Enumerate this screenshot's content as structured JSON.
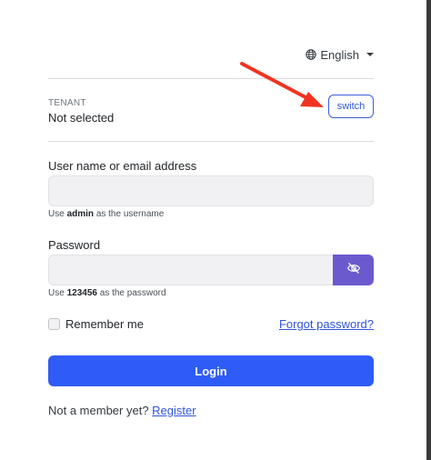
{
  "language": {
    "label": "English"
  },
  "tenant": {
    "caption": "TENANT",
    "value": "Not selected",
    "switch_label": "switch"
  },
  "username": {
    "label": "User name or email address",
    "value": "",
    "hint_prefix": "Use",
    "hint_value": "admin",
    "hint_suffix": "as the username"
  },
  "password": {
    "label": "Password",
    "value": "",
    "hint_prefix": "Use",
    "hint_value": "123456",
    "hint_suffix": "as the password"
  },
  "remember_me": {
    "label": "Remember me",
    "checked": false
  },
  "forgot_password": {
    "label": "Forgot password?"
  },
  "login": {
    "label": "Login"
  },
  "register": {
    "prompt": "Not a member yet?",
    "link": "Register"
  },
  "colors": {
    "primary": "#2f5cf6",
    "eye_button": "#6a5acd",
    "link": "#2f55d4",
    "annotation_arrow": "#f0331f"
  },
  "icons": {
    "language": "globe-icon",
    "password_toggle": "eye-off-icon"
  }
}
